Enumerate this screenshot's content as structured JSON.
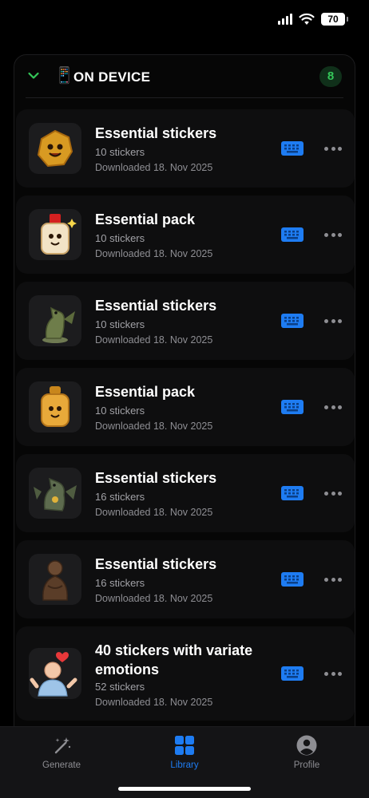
{
  "status_bar": {
    "battery": "70"
  },
  "section": {
    "icon": "mobile-phone-icon",
    "emoji": "📱",
    "title": "ON DEVICE",
    "count": "8",
    "accent_color": "#34c759"
  },
  "packs": [
    {
      "title": "Essential stickers",
      "count": "10 stickers",
      "date": "Downloaded 18. Nov 2025",
      "thumb": "golden-nugget-character"
    },
    {
      "title": "Essential pack",
      "count": "10 stickers",
      "date": "Downloaded 18. Nov 2025",
      "thumb": "perfume-bottle-character"
    },
    {
      "title": "Essential stickers",
      "count": "10 stickers",
      "date": "Downloaded 18. Nov 2025",
      "thumb": "green-dragon-statue"
    },
    {
      "title": "Essential pack",
      "count": "10 stickers",
      "date": "Downloaded 18. Nov 2025",
      "thumb": "gold-perfume-character"
    },
    {
      "title": "Essential stickers",
      "count": "16 stickers",
      "date": "Downloaded 18. Nov 2025",
      "thumb": "dragon-with-medal"
    },
    {
      "title": "Essential stickers",
      "count": "16 stickers",
      "date": "Downloaded 18. Nov 2025",
      "thumb": "bronze-monk-statue"
    },
    {
      "title": "40 stickers with variate emotions",
      "count": "52 stickers",
      "date": "Downloaded 18. Nov 2025",
      "thumb": "old-man-heart"
    }
  ],
  "tabs": [
    {
      "label": "Generate",
      "icon": "magic-wand-icon"
    },
    {
      "label": "Library",
      "icon": "grid-icon"
    },
    {
      "label": "Profile",
      "icon": "profile-icon"
    }
  ],
  "colors": {
    "accent_blue": "#1e7cf2",
    "background": "#000000",
    "card": "#0e0e0f"
  }
}
